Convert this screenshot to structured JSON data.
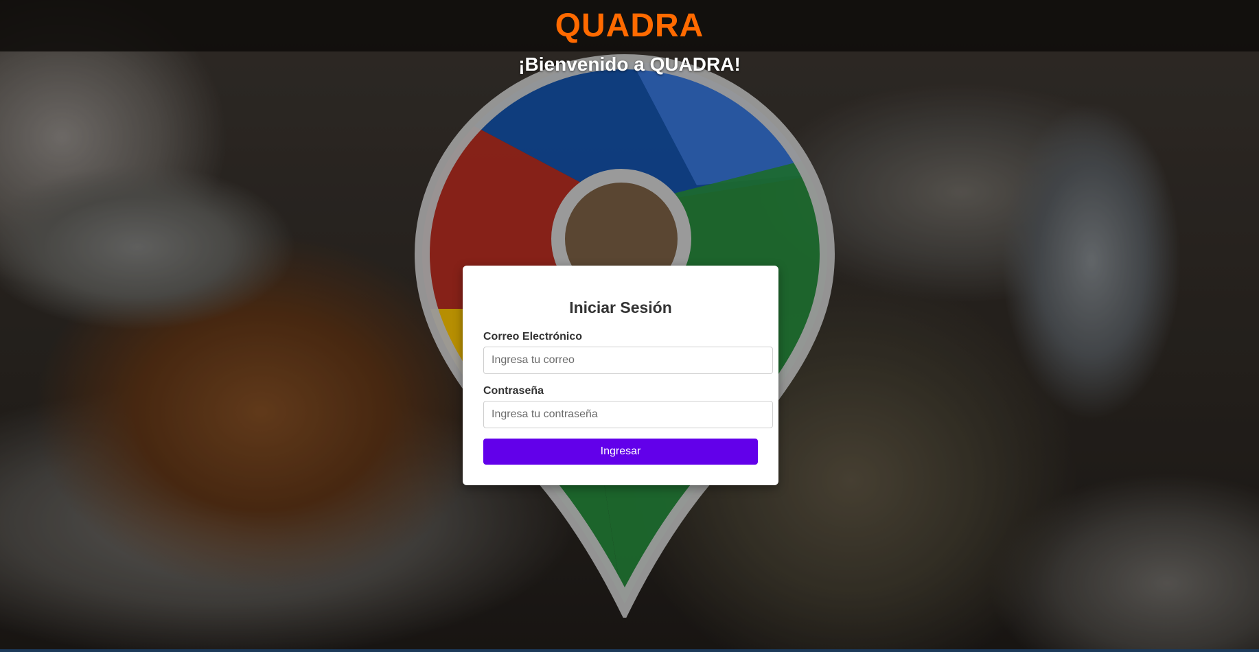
{
  "header": {
    "brand": "QUADRA"
  },
  "hero": {
    "welcome": "¡Bienvenido a QUADRA!"
  },
  "login": {
    "title": "Iniciar Sesión",
    "email_label": "Correo Electrónico",
    "email_placeholder": "Ingresa tu correo",
    "email_value": "",
    "password_label": "Contraseña",
    "password_placeholder": "Ingresa tu contraseña",
    "password_value": "",
    "submit_label": "Ingresar"
  },
  "colors": {
    "brand": "#ff6a00",
    "header_bg": "#0f0c0a",
    "button": "#6200ea",
    "pin_blue": "#0d3f86",
    "pin_red": "#8e2218",
    "pin_yellow": "#c79a00",
    "pin_green": "#1c6a2e",
    "pin_outline": "#9a9a9a"
  },
  "icons": {
    "pin": "map-pin-icon"
  }
}
